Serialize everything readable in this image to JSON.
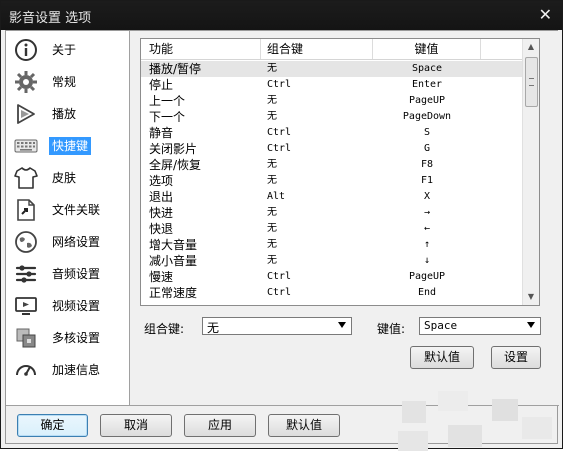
{
  "window": {
    "title": "影音设置 选项",
    "close_glyph": "✕"
  },
  "sidebar": {
    "items": [
      {
        "label": "关于",
        "icon": "info-icon"
      },
      {
        "label": "常规",
        "icon": "gear-icon"
      },
      {
        "label": "播放",
        "icon": "play-icon"
      },
      {
        "label": "快捷键",
        "icon": "keyboard-icon",
        "active": true
      },
      {
        "label": "皮肤",
        "icon": "shirt-icon"
      },
      {
        "label": "文件关联",
        "icon": "file-link-icon"
      },
      {
        "label": "网络设置",
        "icon": "globe-icon"
      },
      {
        "label": "音频设置",
        "icon": "audio-icon"
      },
      {
        "label": "视频设置",
        "icon": "monitor-icon"
      },
      {
        "label": "多核设置",
        "icon": "multicore-icon"
      },
      {
        "label": "加速信息",
        "icon": "speedometer-icon"
      }
    ]
  },
  "shortcuts": {
    "headers": [
      "功能",
      "组合键",
      "键值"
    ],
    "rows": [
      {
        "function": "播放/暂停",
        "combo": "无",
        "key": "Space"
      },
      {
        "function": "停止",
        "combo": "Ctrl",
        "key": "Enter"
      },
      {
        "function": "上一个",
        "combo": "无",
        "key": "PageUP"
      },
      {
        "function": "下一个",
        "combo": "无",
        "key": "PageDown"
      },
      {
        "function": "静音",
        "combo": "Ctrl",
        "key": "S"
      },
      {
        "function": "关闭影片",
        "combo": "Ctrl",
        "key": "G"
      },
      {
        "function": "全屏/恢复",
        "combo": "无",
        "key": "F8"
      },
      {
        "function": "选项",
        "combo": "无",
        "key": "F1"
      },
      {
        "function": "退出",
        "combo": "Alt",
        "key": "X"
      },
      {
        "function": "快进",
        "combo": "无",
        "key": "→"
      },
      {
        "function": "快退",
        "combo": "无",
        "key": "←"
      },
      {
        "function": "增大音量",
        "combo": "无",
        "key": "↑"
      },
      {
        "function": "减小音量",
        "combo": "无",
        "key": "↓"
      },
      {
        "function": "慢速",
        "combo": "Ctrl",
        "key": "PageUP"
      },
      {
        "function": "正常速度",
        "combo": "Ctrl",
        "key": "End"
      }
    ]
  },
  "editor": {
    "combo_label": "组合键:",
    "combo_value": "无",
    "key_label": "键值:",
    "key_value": "Space",
    "default_button": "默认值",
    "set_button": "设置"
  },
  "footer": {
    "ok": "确定",
    "cancel": "取消",
    "apply": "应用",
    "defaults": "默认值"
  },
  "colors": {
    "accent": "#3399ff",
    "titlebar": "#141414",
    "selected_row": "#e5e5e5"
  }
}
